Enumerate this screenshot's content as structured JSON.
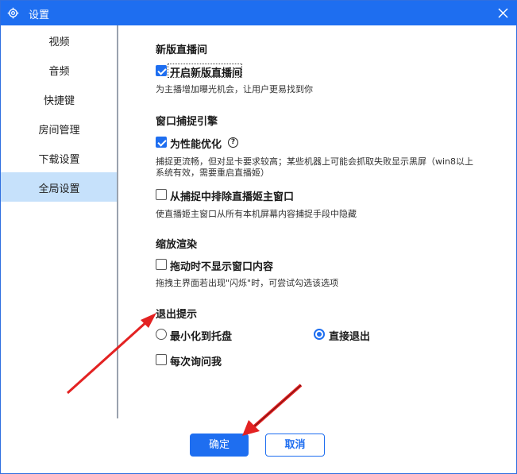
{
  "window": {
    "title": "设置"
  },
  "sidebar": {
    "items": [
      {
        "label": "视频",
        "active": false
      },
      {
        "label": "音频",
        "active": false
      },
      {
        "label": "快捷键",
        "active": false
      },
      {
        "label": "房间管理",
        "active": false
      },
      {
        "label": "下载设置",
        "active": false
      },
      {
        "label": "全局设置",
        "active": true
      }
    ]
  },
  "sections": {
    "new_live": {
      "title": "新版直播间",
      "checkbox_label": "开启新版直播间",
      "checked": true,
      "desc": "为主播增加曝光机会，让用户更易找到你"
    },
    "capture": {
      "title": "窗口捕捉引擎",
      "optimize_label": "为性能优化",
      "optimize_checked": true,
      "optimize_desc_1": "捕捉更流畅，但对显卡要求较高；某些机器上可能会抓取失败显示黑屏（win8以上",
      "optimize_desc_2": "系统有效，需要重启直播姬）",
      "exclude_label": "从捕捉中排除直播姬主窗口",
      "exclude_checked": false,
      "exclude_desc": "使直播姬主窗口从所有本机屏幕内容捕捉手段中隐藏"
    },
    "render": {
      "title": "缩放渲染",
      "no_content_label": "拖动时不显示窗口内容",
      "no_content_checked": false,
      "no_content_desc": "拖拽主界面若出现\"闪烁\"时，可尝试勾选该选项"
    },
    "exit": {
      "title": "退出提示",
      "options": [
        {
          "label": "最小化到托盘",
          "selected": false
        },
        {
          "label": "直接退出",
          "selected": true
        }
      ],
      "ask_label": "每次询问我",
      "ask_checked": false
    }
  },
  "footer": {
    "ok_label": "确定",
    "cancel_label": "取消"
  },
  "colors": {
    "accent": "#1e6ef0",
    "active_sidebar": "#c6e1fb",
    "annotation_arrow": "#e32222"
  }
}
